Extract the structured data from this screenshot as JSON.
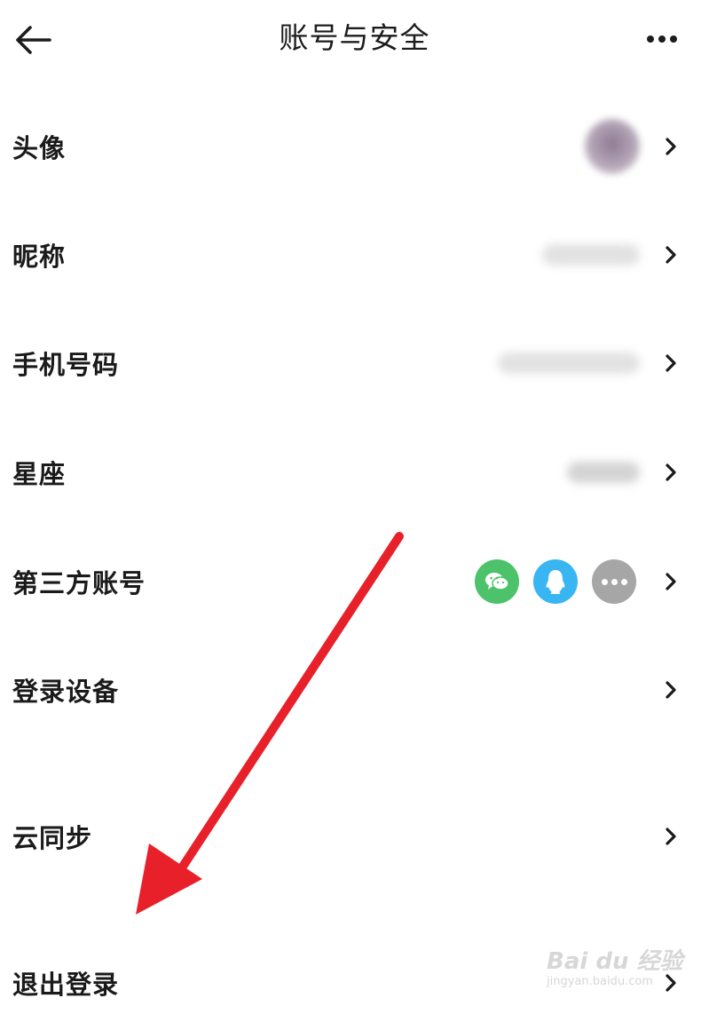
{
  "header": {
    "title": "账号与安全",
    "back_icon": "arrow-left-icon",
    "more_icon": "more-horizontal-icon"
  },
  "rows": [
    {
      "label": "头像",
      "value_type": "avatar"
    },
    {
      "label": "昵称",
      "value_type": "blurred-text"
    },
    {
      "label": "手机号码",
      "value_type": "blurred-text"
    },
    {
      "label": "星座",
      "value_type": "blurred-text"
    },
    {
      "label": "第三方账号",
      "value_type": "icons",
      "icons": [
        "wechat-icon",
        "qq-icon",
        "more-icon"
      ]
    },
    {
      "label": "登录设备",
      "value_type": "none"
    },
    {
      "label": "云同步",
      "value_type": "none"
    },
    {
      "label": "退出登录",
      "value_type": "none"
    }
  ],
  "colors": {
    "wechat": "#4cc26b",
    "qq": "#39b5f2",
    "more": "#a6a6a6",
    "annotation_arrow": "#e8202a"
  },
  "watermark": {
    "brand": "Bai du 经验",
    "url": "jingyan.baidu.com"
  }
}
